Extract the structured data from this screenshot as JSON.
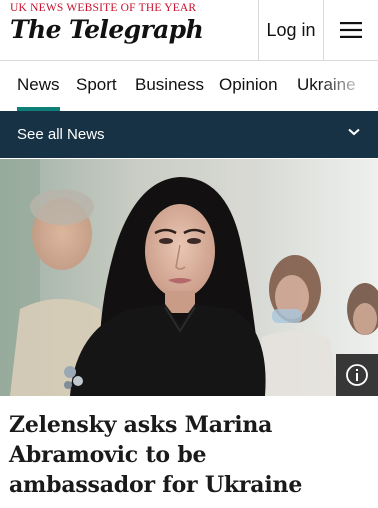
{
  "header": {
    "tagline": "UK NEWS WEBSITE OF THE YEAR",
    "logo_text": "The Telegraph",
    "login_label": "Log in",
    "menu_icon": "hamburger-menu-icon"
  },
  "nav": {
    "items": [
      {
        "label": "News",
        "active": true
      },
      {
        "label": "Sport",
        "active": false
      },
      {
        "label": "Business",
        "active": false
      },
      {
        "label": "Opinion",
        "active": false
      },
      {
        "label": "Ukraine",
        "active": false
      }
    ],
    "accent_color": "#0f7f7a"
  },
  "section_bar": {
    "label": "See all News",
    "icon": "chevron-down-icon",
    "background": "#173245"
  },
  "article": {
    "image_info_icon": "info-icon",
    "headline": "Zelensky asks Marina Abramovic to be ambassador for Ukraine"
  }
}
